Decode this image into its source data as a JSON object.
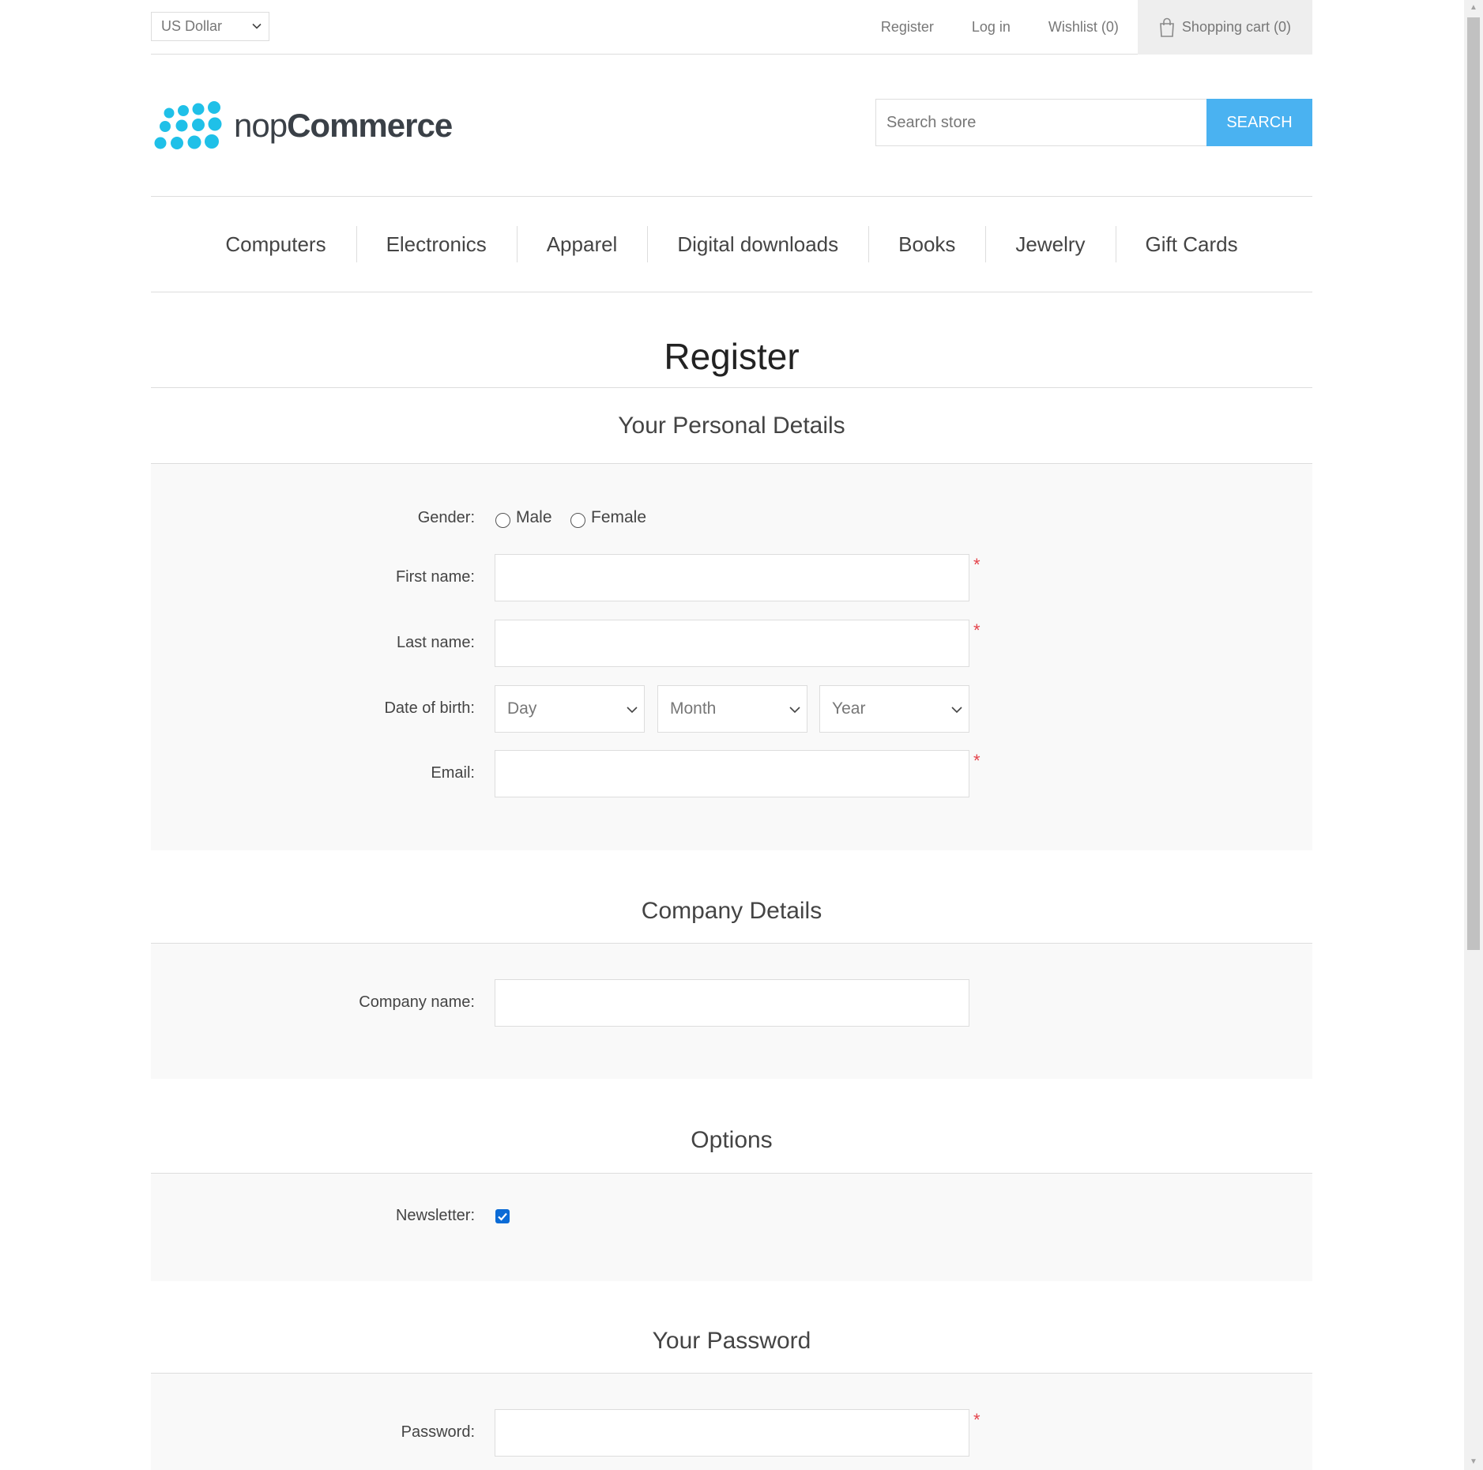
{
  "header": {
    "currency": "US Dollar",
    "links": {
      "register": "Register",
      "login": "Log in",
      "wishlist": "Wishlist (0)",
      "cart": "Shopping cart (0)"
    }
  },
  "logo": {
    "text_light": "nop",
    "text_bold": "Commerce",
    "color": "#1fc0e8"
  },
  "search": {
    "placeholder": "Search store",
    "button_label": "Search",
    "button_color": "#4ab2f1"
  },
  "menu": {
    "items": [
      "Computers",
      "Electronics",
      "Apparel",
      "Digital downloads",
      "Books",
      "Jewelry",
      "Gift Cards"
    ]
  },
  "page": {
    "title": "Register"
  },
  "personal_details": {
    "title": "Your Personal Details",
    "gender_label": "Gender:",
    "gender_options": [
      "Male",
      "Female"
    ],
    "first_name_label": "First name:",
    "last_name_label": "Last name:",
    "dob_label": "Date of birth:",
    "dob_day": "Day",
    "dob_month": "Month",
    "dob_year": "Year",
    "email_label": "Email:",
    "required_mark": "*"
  },
  "company_details": {
    "title": "Company Details",
    "company_name_label": "Company name:"
  },
  "options": {
    "title": "Options",
    "newsletter_label": "Newsletter:",
    "newsletter_checked": true
  },
  "password": {
    "title": "Your Password",
    "password_label": "Password:"
  },
  "colors": {
    "required": "#e4434b",
    "checkbox": "#0b6bd6",
    "section_bg": "#f9f9f9"
  }
}
